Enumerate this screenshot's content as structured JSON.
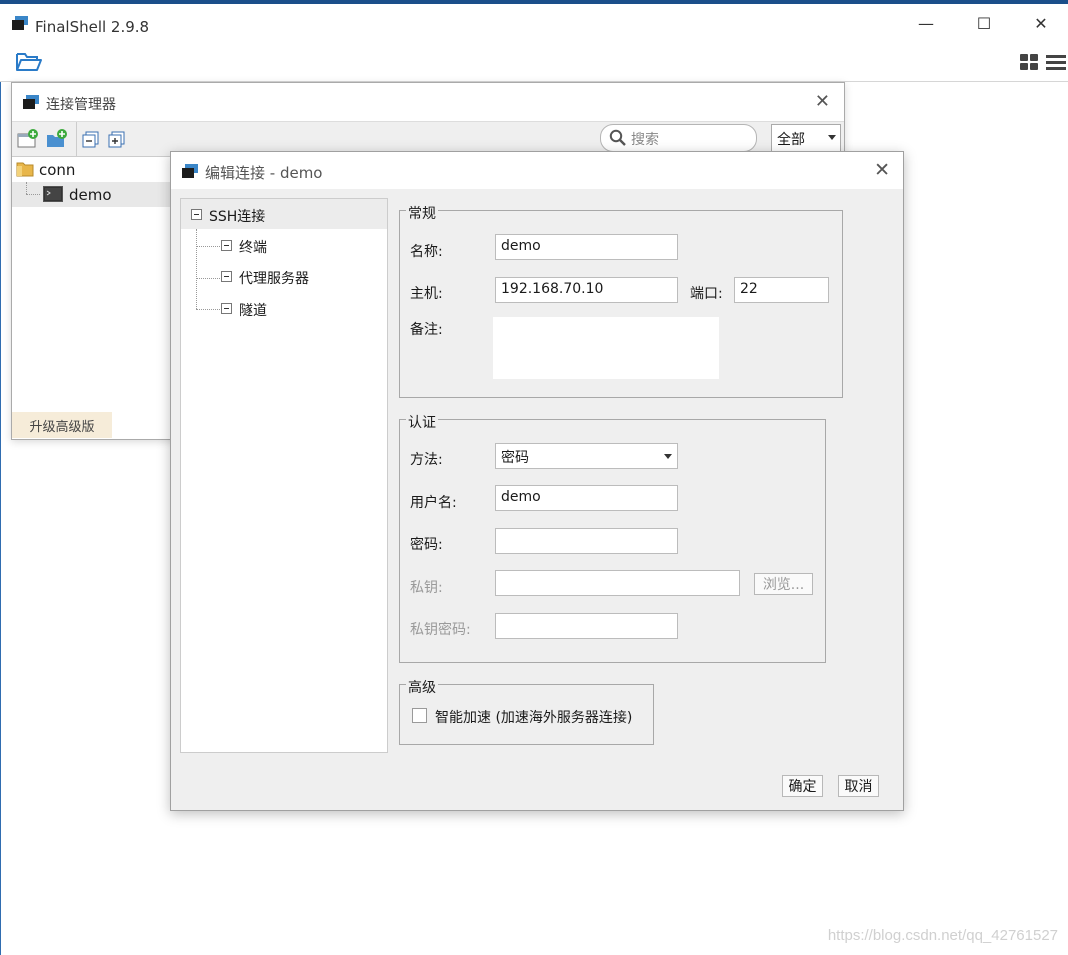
{
  "main_window": {
    "title": "FinalShell 2.9.8",
    "controls": {
      "minimize": "—",
      "maximize": "☐",
      "close": "✕"
    }
  },
  "connection_manager": {
    "title": "连接管理器",
    "search_placeholder": "搜索",
    "filter_selected": "全部",
    "tree": [
      {
        "label": "conn",
        "type": "folder"
      },
      {
        "label": "demo",
        "type": "connection",
        "selected": true
      }
    ],
    "upgrade_label": "升级高级版"
  },
  "edit_dialog": {
    "title": "编辑连接 - demo",
    "nav": [
      {
        "label": "SSH连接",
        "selected": true
      },
      {
        "label": "终端"
      },
      {
        "label": "代理服务器"
      },
      {
        "label": "隧道"
      }
    ],
    "general": {
      "legend": "常规",
      "name_label": "名称:",
      "name_value": "demo",
      "host_label": "主机:",
      "host_value": "192.168.70.10",
      "port_label": "端口:",
      "port_value": "22",
      "note_label": "备注:",
      "note_value": ""
    },
    "auth": {
      "legend": "认证",
      "method_label": "方法:",
      "method_value": "密码",
      "user_label": "用户名:",
      "user_value": "demo",
      "password_label": "密码:",
      "password_value": "",
      "key_label": "私钥:",
      "key_value": "",
      "browse_label": "浏览...",
      "key_password_label": "私钥密码:",
      "key_password_value": ""
    },
    "advanced": {
      "legend": "高级",
      "accel_label": "智能加速 (加速海外服务器连接)",
      "accel_checked": false
    },
    "ok_label": "确定",
    "cancel_label": "取消"
  },
  "watermark": "https://blog.csdn.net/qq_42761527",
  "colors": {
    "accent": "#3a86c8",
    "title_bar": "#1b4f8a",
    "folder": "#e8b64a"
  }
}
